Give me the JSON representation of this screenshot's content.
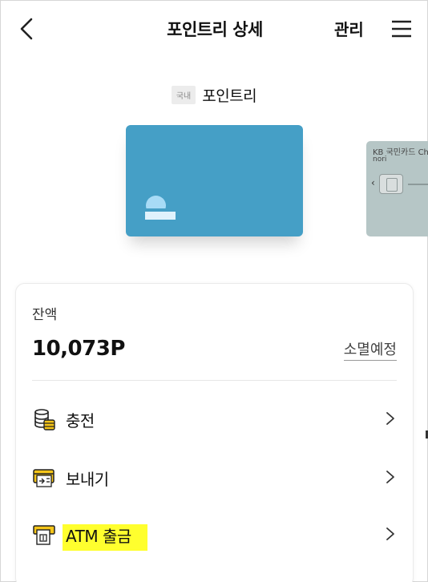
{
  "header": {
    "title": "포인트리 상세",
    "manage_label": "관리"
  },
  "card_section": {
    "badge": "국내",
    "name": "포인트리",
    "next_card": {
      "brand": "KB 국민카드 Chec",
      "sub": "nori"
    }
  },
  "balance": {
    "label": "잔액",
    "value": "10,073P",
    "expire_link": "소멸예정"
  },
  "actions": [
    {
      "label": "충전",
      "icon": "coin-stack-icon"
    },
    {
      "label": "보내기",
      "icon": "card-send-icon"
    },
    {
      "label": "ATM 출금",
      "icon": "atm-icon"
    }
  ],
  "colors": {
    "card_main": "#459fc6",
    "card_next": "#b6c6c6",
    "icon_accent": "#f5c518",
    "highlight": "#ffff2e"
  }
}
